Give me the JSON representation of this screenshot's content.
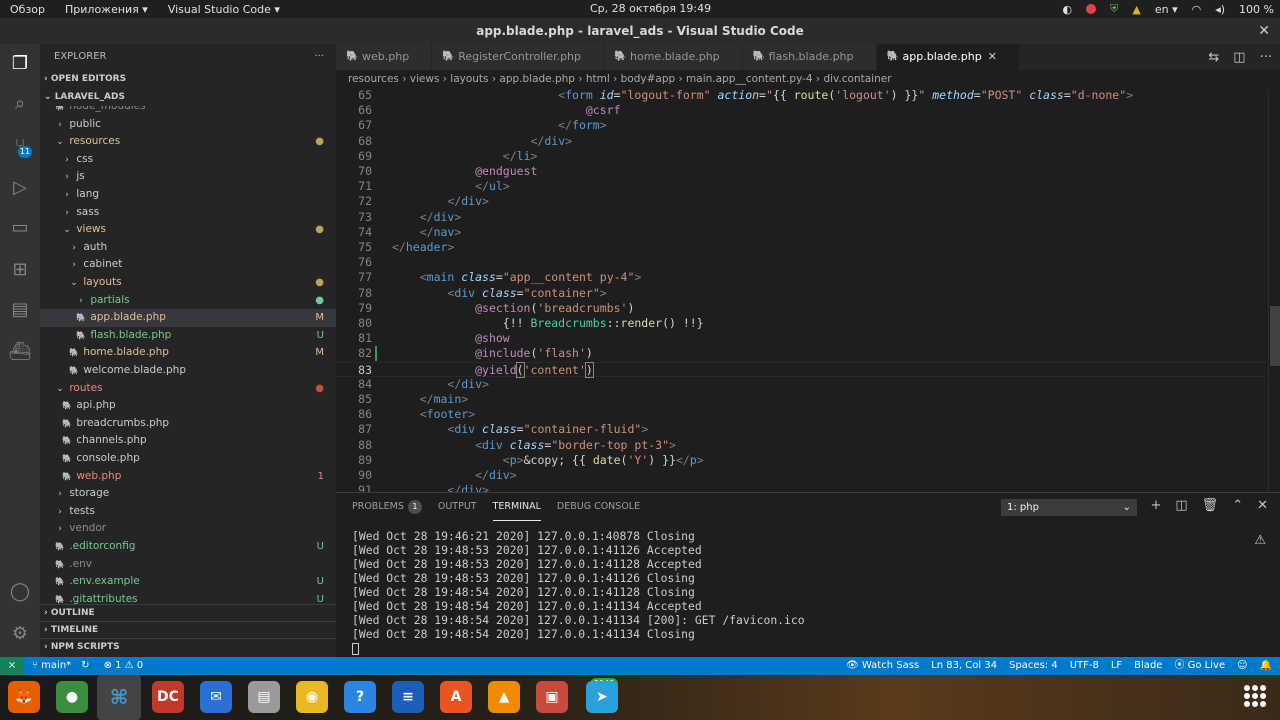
{
  "system": {
    "overview": "Обзор",
    "apps": "Приложения ▾",
    "current_app": "Visual Studio Code ▾",
    "clock": "Ср, 28 октября  19:49",
    "lang": "en ▾",
    "battery": "100 %"
  },
  "window": {
    "title": "app.blade.php - laravel_ads - Visual Studio Code",
    "close": "✕"
  },
  "activity": {
    "scm_badge": "11"
  },
  "explorer": {
    "title": "EXPLORER",
    "more": "···",
    "open_editors": "OPEN EDITORS",
    "project": "LARAVEL_ADS",
    "rows": [
      {
        "label": "node_modules",
        "indent": 0,
        "icon": "",
        "color": "#8b8b8b",
        "status": "",
        "status_color": ""
      },
      {
        "label": "public",
        "indent": 0,
        "icon": "›",
        "color": "#cccccc",
        "status": "",
        "status_color": ""
      },
      {
        "label": "resources",
        "indent": 0,
        "icon": "⌄",
        "color": "#e2c08d",
        "status": "●",
        "status_color": "#c5a05a"
      },
      {
        "label": "css",
        "indent": 1,
        "icon": "›",
        "color": "#cccccc",
        "status": "",
        "status_color": ""
      },
      {
        "label": "js",
        "indent": 1,
        "icon": "›",
        "color": "#cccccc",
        "status": "",
        "status_color": ""
      },
      {
        "label": "lang",
        "indent": 1,
        "icon": "›",
        "color": "#cccccc",
        "status": "",
        "status_color": ""
      },
      {
        "label": "sass",
        "indent": 1,
        "icon": "›",
        "color": "#cccccc",
        "status": "",
        "status_color": ""
      },
      {
        "label": "views",
        "indent": 1,
        "icon": "⌄",
        "color": "#e2c08d",
        "status": "●",
        "status_color": "#c5a05a"
      },
      {
        "label": "auth",
        "indent": 2,
        "icon": "›",
        "color": "#cccccc",
        "status": "",
        "status_color": ""
      },
      {
        "label": "cabinet",
        "indent": 2,
        "icon": "›",
        "color": "#cccccc",
        "status": "",
        "status_color": ""
      },
      {
        "label": "layouts",
        "indent": 2,
        "icon": "⌄",
        "color": "#e2c08d",
        "status": "●",
        "status_color": "#c5a05a"
      },
      {
        "label": "partials",
        "indent": 3,
        "icon": "›",
        "color": "#73c991",
        "status": "●",
        "status_color": "#73c991"
      },
      {
        "label": "app.blade.php",
        "indent": 3,
        "icon": "",
        "color": "#e2c08d",
        "status": "M",
        "status_color": "#e2c08d",
        "selected": true
      },
      {
        "label": "flash.blade.php",
        "indent": 3,
        "icon": "",
        "color": "#73c991",
        "status": "U",
        "status_color": "#73c991"
      },
      {
        "label": "home.blade.php",
        "indent": 2,
        "icon": "",
        "color": "#e2c08d",
        "status": "M",
        "status_color": "#e2c08d"
      },
      {
        "label": "welcome.blade.php",
        "indent": 2,
        "icon": "",
        "color": "#cccccc",
        "status": "",
        "status_color": ""
      },
      {
        "label": "routes",
        "indent": 0,
        "icon": "⌄",
        "color": "#f48771",
        "status": "●",
        "status_color": "#c74e39"
      },
      {
        "label": "api.php",
        "indent": 1,
        "icon": "",
        "color": "#cccccc",
        "status": "",
        "status_color": ""
      },
      {
        "label": "breadcrumbs.php",
        "indent": 1,
        "icon": "",
        "color": "#cccccc",
        "status": "",
        "status_color": ""
      },
      {
        "label": "channels.php",
        "indent": 1,
        "icon": "",
        "color": "#cccccc",
        "status": "",
        "status_color": ""
      },
      {
        "label": "console.php",
        "indent": 1,
        "icon": "",
        "color": "#cccccc",
        "status": "",
        "status_color": ""
      },
      {
        "label": "web.php",
        "indent": 1,
        "icon": "",
        "color": "#f48771",
        "status": "1",
        "status_color": "#f48771"
      },
      {
        "label": "storage",
        "indent": 0,
        "icon": "›",
        "color": "#cccccc",
        "status": "",
        "status_color": ""
      },
      {
        "label": "tests",
        "indent": 0,
        "icon": "›",
        "color": "#cccccc",
        "status": "",
        "status_color": ""
      },
      {
        "label": "vendor",
        "indent": 0,
        "icon": "›",
        "color": "#8b8b8b",
        "status": "",
        "status_color": ""
      },
      {
        "label": ".editorconfig",
        "indent": 0,
        "icon": "",
        "color": "#73c991",
        "status": "U",
        "status_color": "#73c991"
      },
      {
        "label": ".env",
        "indent": 0,
        "icon": "",
        "color": "#8b8b8b",
        "status": "",
        "status_color": ""
      },
      {
        "label": ".env.example",
        "indent": 0,
        "icon": "",
        "color": "#73c991",
        "status": "U",
        "status_color": "#73c991"
      },
      {
        "label": ".gitattributes",
        "indent": 0,
        "icon": "",
        "color": "#73c991",
        "status": "U",
        "status_color": "#73c991"
      }
    ],
    "outline": "OUTLINE",
    "timeline": "TIMELINE",
    "npm": "NPM SCRIPTS"
  },
  "tabs": [
    {
      "label": "web.php",
      "active": false
    },
    {
      "label": "RegisterController.php",
      "active": false
    },
    {
      "label": "home.blade.php",
      "active": false
    },
    {
      "label": "flash.blade.php",
      "active": false
    },
    {
      "label": "app.blade.php",
      "active": true
    }
  ],
  "breadcrumbs": "resources  ›  views  ›  layouts  ›   app.blade.php  ›   html  ›   body#app  ›   main.app__content.py-4  ›   div.container",
  "code": {
    "current_line": 83,
    "modified_line": 82,
    "lines": [
      {
        "n": 65,
        "html": "                        <span class='k'>&lt;</span><span class='t'>form</span> <span class='a'>id</span>=<span class='s'>\"logout-form\"</span> <span class='a'>action</span>=<span class='s'>\"</span><span class='p'>{{ </span><span class='f'>route</span><span class='p'>(</span><span class='s'>'logout'</span><span class='p'>) }}</span><span class='s'>\"</span> <span class='a'>method</span>=<span class='s'>\"POST\"</span> <span class='a'>class</span>=<span class='s'>\"d-none\"</span><span class='k'>&gt;</span>"
      },
      {
        "n": 66,
        "html": "                            <span class='d'>@csrf</span>"
      },
      {
        "n": 67,
        "html": "                        <span class='k'>&lt;/</span><span class='t'>form</span><span class='k'>&gt;</span>"
      },
      {
        "n": 68,
        "html": "                    <span class='k'>&lt;/</span><span class='t'>div</span><span class='k'>&gt;</span>"
      },
      {
        "n": 69,
        "html": "                <span class='k'>&lt;/</span><span class='t'>li</span><span class='k'>&gt;</span>"
      },
      {
        "n": 70,
        "html": "            <span class='d'>@endguest</span>"
      },
      {
        "n": 71,
        "html": "            <span class='k'>&lt;/</span><span class='t'>ul</span><span class='k'>&gt;</span>"
      },
      {
        "n": 72,
        "html": "        <span class='k'>&lt;/</span><span class='t'>div</span><span class='k'>&gt;</span>"
      },
      {
        "n": 73,
        "html": "    <span class='k'>&lt;/</span><span class='t'>div</span><span class='k'>&gt;</span>"
      },
      {
        "n": 74,
        "html": "    <span class='k'>&lt;/</span><span class='t'>nav</span><span class='k'>&gt;</span>"
      },
      {
        "n": 75,
        "html": "<span class='k'>&lt;/</span><span class='t'>header</span><span class='k'>&gt;</span>"
      },
      {
        "n": 76,
        "html": ""
      },
      {
        "n": 77,
        "html": "    <span class='k'>&lt;</span><span class='t'>main</span> <span class='a'>class</span>=<span class='s'>\"app__content py-4\"</span><span class='k'>&gt;</span>"
      },
      {
        "n": 78,
        "html": "        <span class='k'>&lt;</span><span class='t'>div</span> <span class='a'>class</span>=<span class='s'>\"container\"</span><span class='k'>&gt;</span>"
      },
      {
        "n": 79,
        "html": "            <span class='d'>@section</span><span class='p'>(</span><span class='s'>'breadcrumbs'</span><span class='p'>)</span>"
      },
      {
        "n": 80,
        "html": "                <span class='p'>{!! </span><span class='g'>Breadcrumbs</span><span class='p'>::</span><span class='f'>render</span><span class='p'>() !!}</span>"
      },
      {
        "n": 81,
        "html": "            <span class='d'>@show</span>"
      },
      {
        "n": 82,
        "html": "            <span class='d'>@include</span><span class='p'>(</span><span class='s'>'flash'</span><span class='p'>)</span>"
      },
      {
        "n": 83,
        "html": "            <span class='d'>@yield</span><span class='p' style='outline:1px solid #888'>(</span><span class='s'>'content'</span><span class='p' style='outline:1px solid #888'>)</span>"
      },
      {
        "n": 84,
        "html": "        <span class='k'>&lt;/</span><span class='t'>div</span><span class='k'>&gt;</span>"
      },
      {
        "n": 85,
        "html": "    <span class='k'>&lt;/</span><span class='t'>main</span><span class='k'>&gt;</span>"
      },
      {
        "n": 86,
        "html": "    <span class='k'>&lt;</span><span class='t'>footer</span><span class='k'>&gt;</span>"
      },
      {
        "n": 87,
        "html": "        <span class='k'>&lt;</span><span class='t'>div</span> <span class='a'>class</span>=<span class='s'>\"container-fluid\"</span><span class='k'>&gt;</span>"
      },
      {
        "n": 88,
        "html": "            <span class='k'>&lt;</span><span class='t'>div</span> <span class='a'>class</span>=<span class='s'>\"border-top pt-3\"</span><span class='k'>&gt;</span>"
      },
      {
        "n": 89,
        "html": "                <span class='k'>&lt;</span><span class='t'>p</span><span class='k'>&gt;</span><span class='p'>&amp;copy; {{ </span><span class='f'>date</span><span class='p'>(</span><span class='s'>'Y'</span><span class='p'>) }}</span><span class='k'>&lt;/</span><span class='t'>p</span><span class='k'>&gt;</span>"
      },
      {
        "n": 90,
        "html": "            <span class='k'>&lt;/</span><span class='t'>div</span><span class='k'>&gt;</span>"
      },
      {
        "n": 91,
        "html": "        <span class='k'>&lt;/</span><span class='t'>div</span><span class='k'>&gt;</span>"
      }
    ]
  },
  "panel": {
    "tabs": [
      {
        "label": "PROBLEMS",
        "badge": "1",
        "active": false
      },
      {
        "label": "OUTPUT",
        "badge": "",
        "active": false
      },
      {
        "label": "TERMINAL",
        "badge": "",
        "active": true
      },
      {
        "label": "DEBUG CONSOLE",
        "badge": "",
        "active": false
      }
    ],
    "terminal_select": "1: php",
    "terminal_lines": [
      "[Wed Oct 28 19:46:21 2020] 127.0.0.1:40878 Closing",
      "[Wed Oct 28 19:48:53 2020] 127.0.0.1:41126 Accepted",
      "[Wed Oct 28 19:48:53 2020] 127.0.0.1:41128 Accepted",
      "[Wed Oct 28 19:48:53 2020] 127.0.0.1:41126 Closing",
      "[Wed Oct 28 19:48:54 2020] 127.0.0.1:41128 Closing",
      "[Wed Oct 28 19:48:54 2020] 127.0.0.1:41134 Accepted",
      "[Wed Oct 28 19:48:54 2020] 127.0.0.1:41134 [200]: GET /favicon.ico",
      "[Wed Oct 28 19:48:54 2020] 127.0.0.1:41134 Closing"
    ]
  },
  "statusbar": {
    "remote": "⨯",
    "branch": "⑂ main*",
    "sync": "↻",
    "problems": "⊗ 1 ⚠ 0",
    "watch_sass": "👁 Watch Sass",
    "position": "Ln 83, Col 34",
    "spaces": "Spaces: 4",
    "encoding": "UTF-8",
    "eol": "LF",
    "language": "Blade",
    "go_live": "⦿ Go Live",
    "feedback": "☺",
    "bell": "🔔"
  },
  "dock": {
    "telegram_badge": "5149",
    "apps": [
      {
        "name": "firefox-icon",
        "glyph": "🦊",
        "bg": "#e66000"
      },
      {
        "name": "chrome-icon",
        "glyph": "●",
        "bg": "#3c8d40"
      },
      {
        "name": "vscode-icon",
        "glyph": "⌘",
        "bg": "#1f6fbf"
      },
      {
        "name": "dbeaver-icon",
        "glyph": "DC",
        "bg": "#c0392b"
      },
      {
        "name": "thunderbird-icon",
        "glyph": "✉",
        "bg": "#2a6fd1"
      },
      {
        "name": "files-icon",
        "glyph": "▤",
        "bg": "#9a9a9a"
      },
      {
        "name": "rhythmbox-icon",
        "glyph": "◉",
        "bg": "#e8b923"
      },
      {
        "name": "help-icon",
        "glyph": "?",
        "bg": "#2b86e3"
      },
      {
        "name": "writer-icon",
        "glyph": "≡",
        "bg": "#1c5fb8"
      },
      {
        "name": "software-icon",
        "glyph": "A",
        "bg": "#e95420"
      },
      {
        "name": "vlc-icon",
        "glyph": "▲",
        "bg": "#f08a00"
      },
      {
        "name": "screenshot-icon",
        "glyph": "▣",
        "bg": "#c94a3d"
      },
      {
        "name": "telegram-icon",
        "glyph": "➤",
        "bg": "#2aa1da"
      }
    ]
  }
}
